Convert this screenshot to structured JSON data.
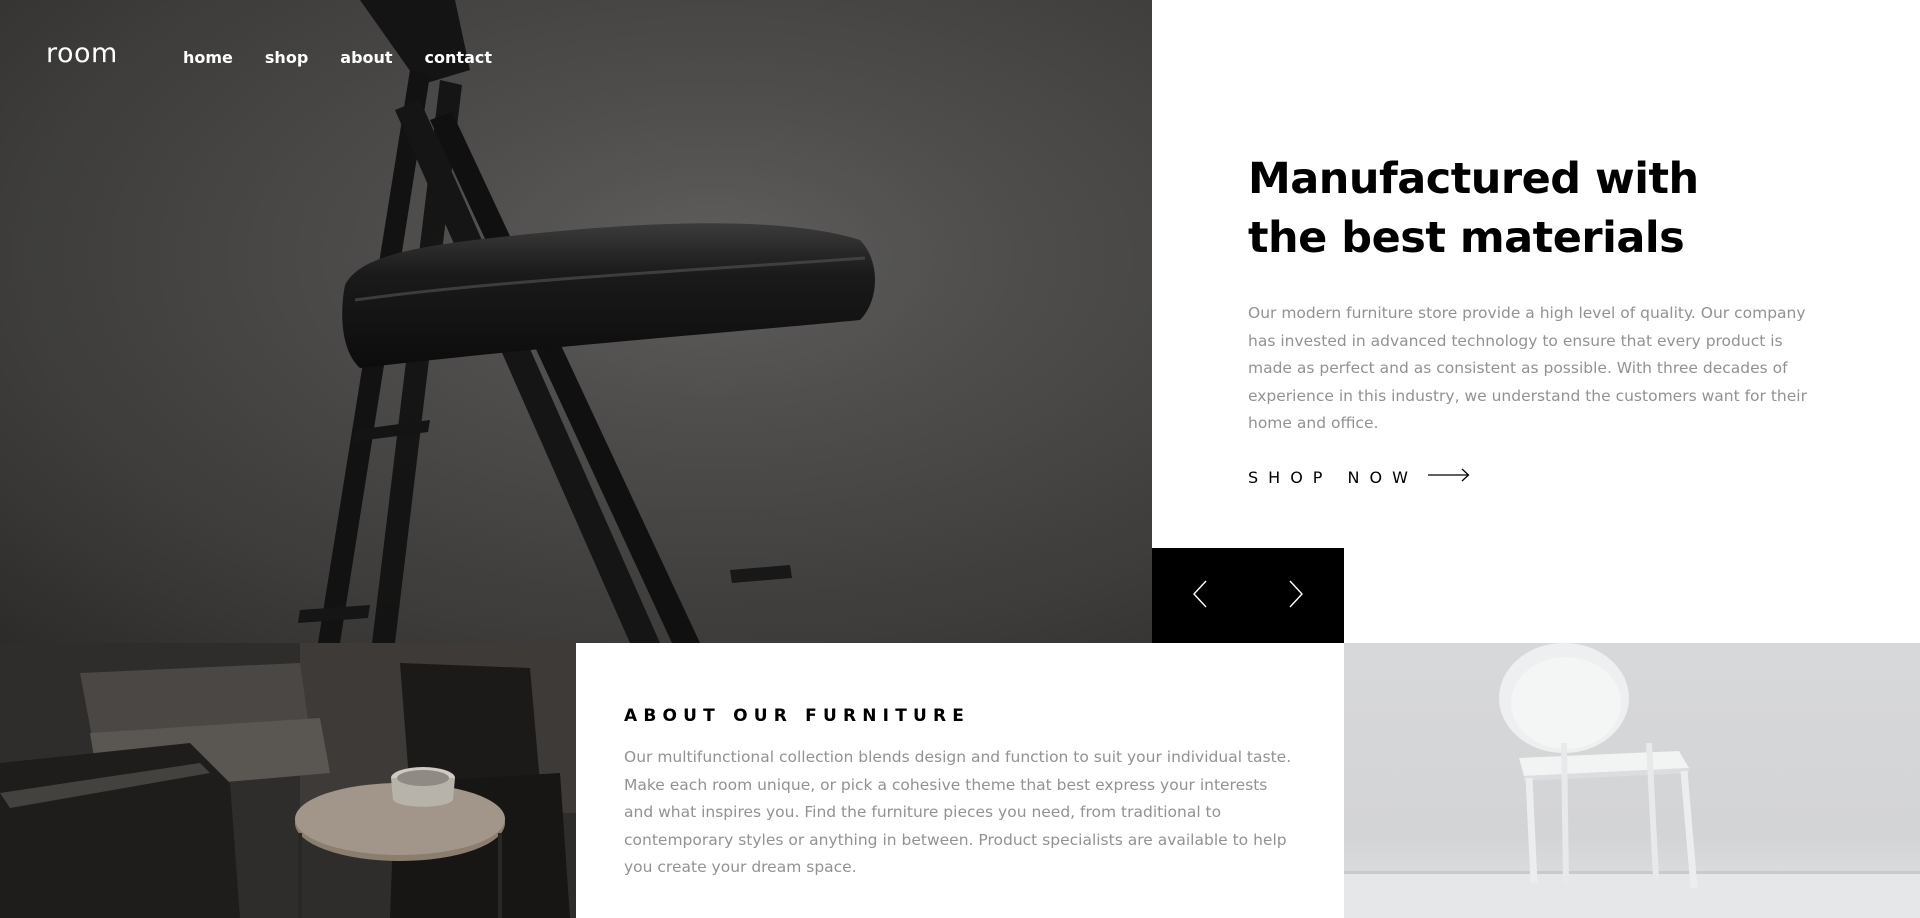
{
  "brand": {
    "logo": "room"
  },
  "nav": {
    "items": [
      {
        "label": "home"
      },
      {
        "label": "shop"
      },
      {
        "label": "about"
      },
      {
        "label": "contact"
      }
    ]
  },
  "hero": {
    "title_line1": "Manufactured with",
    "title_line2": "the best materials",
    "description": "Our modern furniture store provide a high level of quality. Our company has invested in advanced technology to ensure that every product is made as perfect and as consistent as possible. With three decades of experience in this industry, we understand the customers want for their home and office.",
    "cta_label": "SHOP NOW",
    "cta_icon": "arrow-right-icon"
  },
  "slider": {
    "prev_icon": "chevron-left-icon",
    "next_icon": "chevron-right-icon"
  },
  "about": {
    "title": "ABOUT OUR FURNITURE",
    "description": "Our multifunctional collection blends design and function to suit your individual taste. Make each room unique, or pick a cohesive theme that best express your interests and what inspires you. Find the furniture pieces you need, from traditional to contemporary styles or anything in between. Product specialists are available to help you create your dream space."
  },
  "colors": {
    "text_primary": "#000000",
    "text_muted": "#929292",
    "nav_text": "#ffffff",
    "control_bg": "#000000"
  }
}
